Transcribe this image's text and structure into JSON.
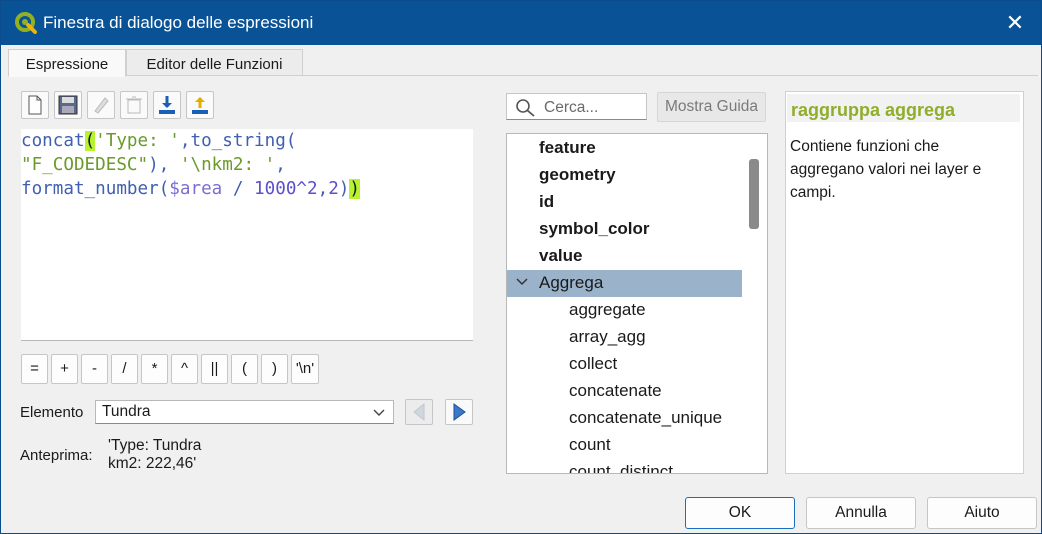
{
  "window": {
    "title": "Finestra di dialogo delle espressioni",
    "close_glyph": "✕"
  },
  "tabs": [
    {
      "label": "Espressione",
      "active": true
    },
    {
      "label": "Editor delle Funzioni",
      "active": false
    }
  ],
  "toolbar": {
    "buttons": [
      {
        "icon": "new-file-icon"
      },
      {
        "icon": "save-icon"
      },
      {
        "icon": "edit-icon"
      },
      {
        "icon": "delete-icon"
      },
      {
        "icon": "import-icon"
      },
      {
        "icon": "export-icon"
      }
    ]
  },
  "editor": {
    "line1": {
      "t1": "concat",
      "t2": "(",
      "t3": "'Type: '",
      "t4": ",to_string("
    },
    "line2": {
      "t1": "\"F_CODEDESC\"",
      "t2": "), ",
      "t3": "'\\nkm2: '",
      "t4": ","
    },
    "line3": {
      "t1": "format_number(",
      "t2": "$area",
      "t3": " / ",
      "t4": "1000^2",
      "t5": ",",
      "t6": "2",
      "t7": ")",
      "t8": ")"
    }
  },
  "operators": [
    "=",
    "+",
    "-",
    "/",
    "*",
    "^",
    "||",
    "(",
    ")",
    "'\\n'"
  ],
  "feature": {
    "label": "Elemento",
    "value": "Tundra"
  },
  "preview": {
    "label": "Anteprima:",
    "value": "'Type: Tundra\nkm2: 222,46'"
  },
  "search": {
    "placeholder": "Cerca..."
  },
  "help_button": "Mostra Guida",
  "tree": {
    "groups": [
      "feature",
      "geometry",
      "id",
      "symbol_color",
      "value"
    ],
    "expanded_group": "Aggrega",
    "functions": [
      "aggregate",
      "array_agg",
      "collect",
      "concatenate",
      "concatenate_unique",
      "count",
      "count_distinct"
    ]
  },
  "help": {
    "title": "raggruppa aggrega",
    "description": "Contiene funzioni che aggregano valori nei layer e campi."
  },
  "buttons": {
    "ok": "OK",
    "cancel": "Annulla",
    "help": "Aiuto"
  },
  "colors": {
    "titlebar": "#0a5296",
    "selection": "#9ab3cb",
    "help_title": "#8fae2b",
    "bracket_highlight": "#b5f42e"
  }
}
